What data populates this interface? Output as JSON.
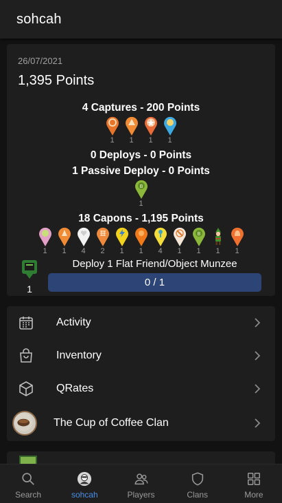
{
  "header": {
    "title": "sohcah"
  },
  "day": {
    "date": "26/07/2021",
    "total": "1,395 Points",
    "captures": {
      "title": "4 Captures - 200 Points",
      "items": [
        {
          "icon": "orange-ring-munzee-icon",
          "count": "1"
        },
        {
          "icon": "orange-tent-munzee-icon",
          "count": "1"
        },
        {
          "icon": "orange-star-munzee-icon",
          "count": "1"
        },
        {
          "icon": "blue-munzee-icon",
          "count": "1"
        }
      ]
    },
    "deploys": {
      "title": "0 Deploys - 0 Points"
    },
    "passive": {
      "title": "1 Passive Deploy - 0 Points",
      "items": [
        {
          "icon": "green-munzee-icon",
          "count": "1"
        }
      ]
    },
    "capons": {
      "title": "18 Capons - 1,195 Points",
      "items": [
        {
          "icon": "pink-munzee-icon",
          "count": "1"
        },
        {
          "icon": "orange-munzee-icon",
          "count": "1"
        },
        {
          "icon": "white-heart-munzee-icon",
          "count": "4"
        },
        {
          "icon": "orange-basket-munzee-icon",
          "count": "2"
        },
        {
          "icon": "yellow-bolt-munzee-icon",
          "count": "1"
        },
        {
          "icon": "orange-flower-munzee-icon",
          "count": "1"
        },
        {
          "icon": "yellow-key-munzee-icon",
          "count": "4"
        },
        {
          "icon": "white-tool-munzee-icon",
          "count": "1"
        },
        {
          "icon": "green-b-munzee-icon",
          "count": "1"
        },
        {
          "icon": "green-elf-icon",
          "count": "1"
        },
        {
          "icon": "orange-bell-munzee-icon",
          "count": "1"
        }
      ]
    },
    "goal": {
      "count": "1",
      "label": "Deploy 1 Flat Friend/Object Munzee",
      "progress_text": "0 / 1",
      "progress": 0
    }
  },
  "menu": {
    "items": [
      {
        "label": "Activity",
        "icon": "calendar-icon"
      },
      {
        "label": "Inventory",
        "icon": "bag-icon"
      },
      {
        "label": "QRates",
        "icon": "cube-icon"
      },
      {
        "label": "The Cup of Coffee Clan",
        "icon": "clan-avatar"
      }
    ]
  },
  "nav": {
    "items": [
      {
        "label": "Search",
        "icon": "search-icon"
      },
      {
        "label": "sohcah",
        "icon": "user-avatar-icon"
      },
      {
        "label": "Players",
        "icon": "players-icon"
      },
      {
        "label": "Clans",
        "icon": "shield-icon"
      },
      {
        "label": "More",
        "icon": "grid-icon"
      }
    ]
  },
  "colors": {
    "background": "#121212",
    "card": "#1e1e1e",
    "progress_bar": "#2c4476",
    "active_nav": "#4a8fe7"
  }
}
